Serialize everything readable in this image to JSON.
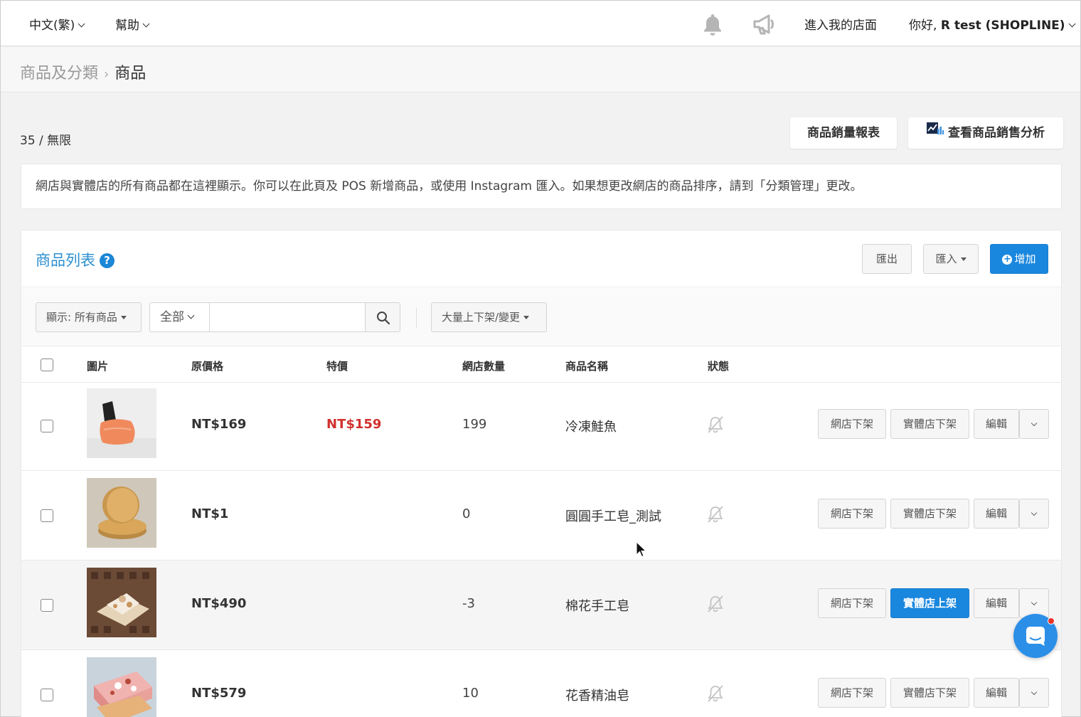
{
  "topbar": {
    "language": "中文(繁)",
    "help": "幫助",
    "store_link": "進入我的店面",
    "greeting": "你好,",
    "user_name": "R test (SHOPLINE)"
  },
  "breadcrumb": {
    "parent": "商品及分類",
    "current": "商品"
  },
  "product_count": "35 / 無限",
  "actions": {
    "sales_report": "商品銷量報表",
    "sales_analysis": "查看商品銷售分析"
  },
  "notice": "網店與實體店的所有商品都在這裡顯示。你可以在此頁及 POS 新增商品，或使用 Instagram 匯入。如果想更改網店的商品排序，請到「分類管理」更改。",
  "panel": {
    "title": "商品列表",
    "help_icon": "?",
    "export": "匯出",
    "import": "匯入",
    "add": "增加"
  },
  "filters": {
    "display": "顯示: 所有商品",
    "scope": "全部",
    "search_value": "",
    "bulk": "大量上下架/變更"
  },
  "columns": {
    "image": "圖片",
    "price": "原價格",
    "sale": "特價",
    "qty": "網店數量",
    "name": "商品名稱",
    "status": "狀態"
  },
  "rows": [
    {
      "price": "NT$169",
      "sale": "NT$159",
      "qty": "199",
      "name": "冷凍鮭魚",
      "online_btn": "網店下架",
      "store_btn": "實體店下架",
      "store_btn_primary": false,
      "edit": "編輯"
    },
    {
      "price": "NT$1",
      "sale": "",
      "qty": "0",
      "name": "圓圓手工皂_測試",
      "online_btn": "網店下架",
      "store_btn": "實體店下架",
      "store_btn_primary": false,
      "edit": "編輯"
    },
    {
      "price": "NT$490",
      "sale": "",
      "qty": "-3",
      "name": "棉花手工皂",
      "online_btn": "網店下架",
      "store_btn": "實體店上架",
      "store_btn_primary": true,
      "edit": "編輯"
    },
    {
      "price": "NT$579",
      "sale": "",
      "qty": "10",
      "name": "花香精油皂",
      "online_btn": "網店下架",
      "store_btn": "實體店下架",
      "store_btn_primary": false,
      "edit": "編輯"
    }
  ],
  "colors": {
    "accent": "#1a87de",
    "sale_red": "#d0312d",
    "title_blue": "#2a8fd0"
  },
  "icons": [
    "bell-icon",
    "megaphone-icon",
    "chart-icon",
    "help-icon",
    "search-icon",
    "plus-circle-icon",
    "bell-off-icon",
    "chat-icon",
    "cursor-icon"
  ]
}
